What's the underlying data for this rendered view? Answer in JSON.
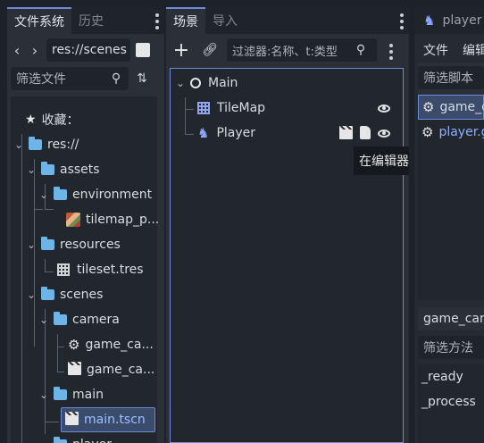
{
  "filesystem": {
    "tabs": [
      {
        "label": "文件系统",
        "active": true
      },
      {
        "label": "历史",
        "active": false
      }
    ],
    "path": "res://scenes",
    "filter_placeholder": "筛选文件",
    "tree": [
      {
        "label": "收藏：",
        "kind": "favorites"
      },
      {
        "label": "res://",
        "kind": "folder"
      },
      {
        "label": "assets",
        "kind": "folder"
      },
      {
        "label": "environment",
        "kind": "folder"
      },
      {
        "label": "tilemap_p...",
        "kind": "image"
      },
      {
        "label": "resources",
        "kind": "folder"
      },
      {
        "label": "tileset.tres",
        "kind": "tileset"
      },
      {
        "label": "scenes",
        "kind": "folder"
      },
      {
        "label": "camera",
        "kind": "folder"
      },
      {
        "label": "game_ca...",
        "kind": "script"
      },
      {
        "label": "game_ca...",
        "kind": "scene"
      },
      {
        "label": "main",
        "kind": "folder"
      },
      {
        "label": "main.tscn",
        "kind": "scene",
        "selected": true
      },
      {
        "label": "player",
        "kind": "folder"
      }
    ]
  },
  "scene": {
    "tabs": [
      {
        "label": "场景",
        "active": true
      },
      {
        "label": "导入",
        "active": false
      }
    ],
    "filter_placeholder": "过滤器:名称、t:类型",
    "nodes": [
      {
        "label": "Main",
        "type": "Node2D"
      },
      {
        "label": "TileMap",
        "type": "TileMap"
      },
      {
        "label": "Player",
        "type": "Player"
      }
    ],
    "tooltip": "在编辑器中打开"
  },
  "script": {
    "title": "player",
    "menu": [
      "文件",
      "编辑"
    ],
    "filter_scripts_placeholder": "筛选脚本",
    "scripts": [
      "game_c",
      "player.g"
    ],
    "current_script": "game_cam",
    "filter_methods_placeholder": "筛选方法",
    "methods": [
      "_ready",
      "_process"
    ]
  },
  "colors": {
    "accent": "#6b8bd6",
    "selected": "#3a4b6b",
    "folder": "#6fb4e6",
    "script_link": "#8fb1ff"
  }
}
